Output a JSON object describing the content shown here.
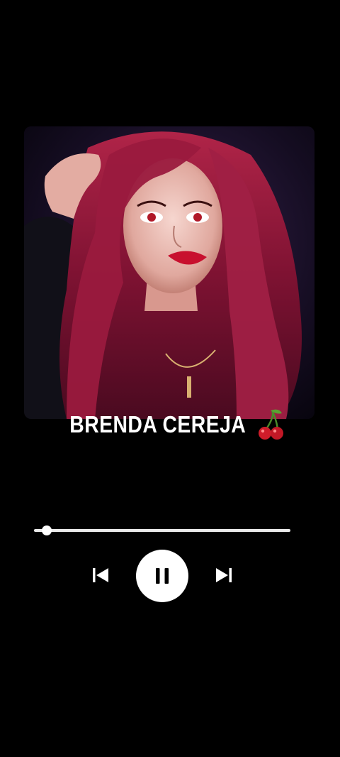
{
  "player": {
    "song_title": "BRENDA CEREJA",
    "title_emoji": "cherry-icon",
    "progress_fraction": 0.05,
    "state": "playing",
    "controls": {
      "previous": "skip-previous-icon",
      "play_pause": "pause-icon",
      "next": "skip-next-icon"
    }
  },
  "colors": {
    "background": "#000000",
    "progress_track": "#eaeaea",
    "play_button_bg": "#ffffff",
    "icon": "#ffffff",
    "pause_glyph": "#000000",
    "hair": "#8c1838",
    "lips": "#c8102e",
    "cherry": "#d01c2a"
  }
}
